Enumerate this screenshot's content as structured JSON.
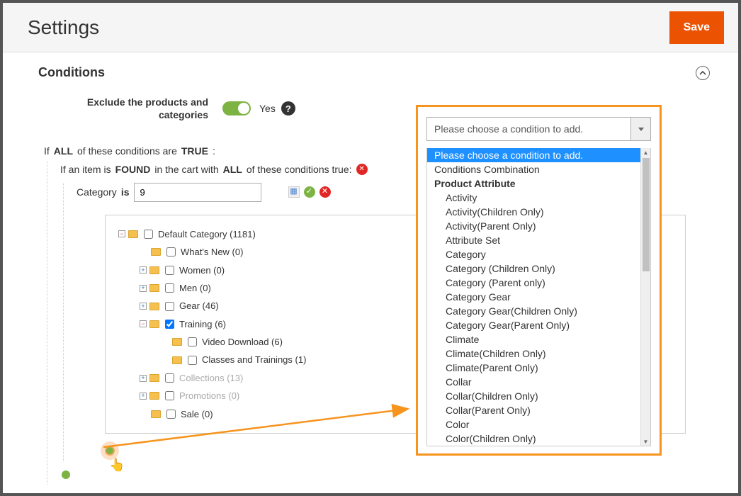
{
  "header": {
    "title": "Settings",
    "save_label": "Save"
  },
  "section": {
    "title": "Conditions"
  },
  "exclude": {
    "label": "Exclude the products and categories",
    "value_text": "Yes"
  },
  "condition_text": {
    "prefix1": "If",
    "all": "ALL",
    "prefix2": "of these conditions are",
    "true": "TRUE",
    "colon": ":",
    "sub_prefix1": "If an item is",
    "found": "FOUND",
    "sub_prefix2": "in the cart with",
    "sub_prefix3": "of these conditions true:",
    "category": "Category",
    "is": "is",
    "value": "9"
  },
  "tree": {
    "root": {
      "label": "Default Category (1181)",
      "checked": false
    },
    "children": [
      {
        "label": "What's New (0)",
        "expander": "",
        "checked": false
      },
      {
        "label": "Women (0)",
        "expander": "plus",
        "checked": false
      },
      {
        "label": "Men (0)",
        "expander": "plus",
        "checked": false
      },
      {
        "label": "Gear (46)",
        "expander": "plus",
        "checked": false
      },
      {
        "label": "Training (6)",
        "expander": "minus",
        "checked": true,
        "children": [
          {
            "label": "Video Download (6)",
            "checked": false
          },
          {
            "label": "Classes and Trainings (1)",
            "checked": false
          }
        ]
      },
      {
        "label": "Collections (13)",
        "expander": "plus",
        "checked": false,
        "dim": true
      },
      {
        "label": "Promotions (0)",
        "expander": "plus",
        "checked": false,
        "dim": true
      },
      {
        "label": "Sale (0)",
        "expander": "",
        "checked": false
      }
    ]
  },
  "dropdown": {
    "placeholder": "Please choose a condition to add.",
    "options": [
      {
        "label": "Please choose a condition to add.",
        "selected": true
      },
      {
        "label": "Conditions Combination"
      },
      {
        "label": "Product Attribute",
        "header": true
      },
      {
        "label": "Activity",
        "indent": true
      },
      {
        "label": "Activity(Children Only)",
        "indent": true
      },
      {
        "label": "Activity(Parent Only)",
        "indent": true
      },
      {
        "label": "Attribute Set",
        "indent": true
      },
      {
        "label": "Category",
        "indent": true
      },
      {
        "label": "Category (Children Only)",
        "indent": true
      },
      {
        "label": "Category (Parent only)",
        "indent": true
      },
      {
        "label": "Category Gear",
        "indent": true
      },
      {
        "label": "Category Gear(Children Only)",
        "indent": true
      },
      {
        "label": "Category Gear(Parent Only)",
        "indent": true
      },
      {
        "label": "Climate",
        "indent": true
      },
      {
        "label": "Climate(Children Only)",
        "indent": true
      },
      {
        "label": "Climate(Parent Only)",
        "indent": true
      },
      {
        "label": "Collar",
        "indent": true
      },
      {
        "label": "Collar(Children Only)",
        "indent": true
      },
      {
        "label": "Collar(Parent Only)",
        "indent": true
      },
      {
        "label": "Color",
        "indent": true
      },
      {
        "label": "Color(Children Only)",
        "indent": true
      }
    ]
  }
}
